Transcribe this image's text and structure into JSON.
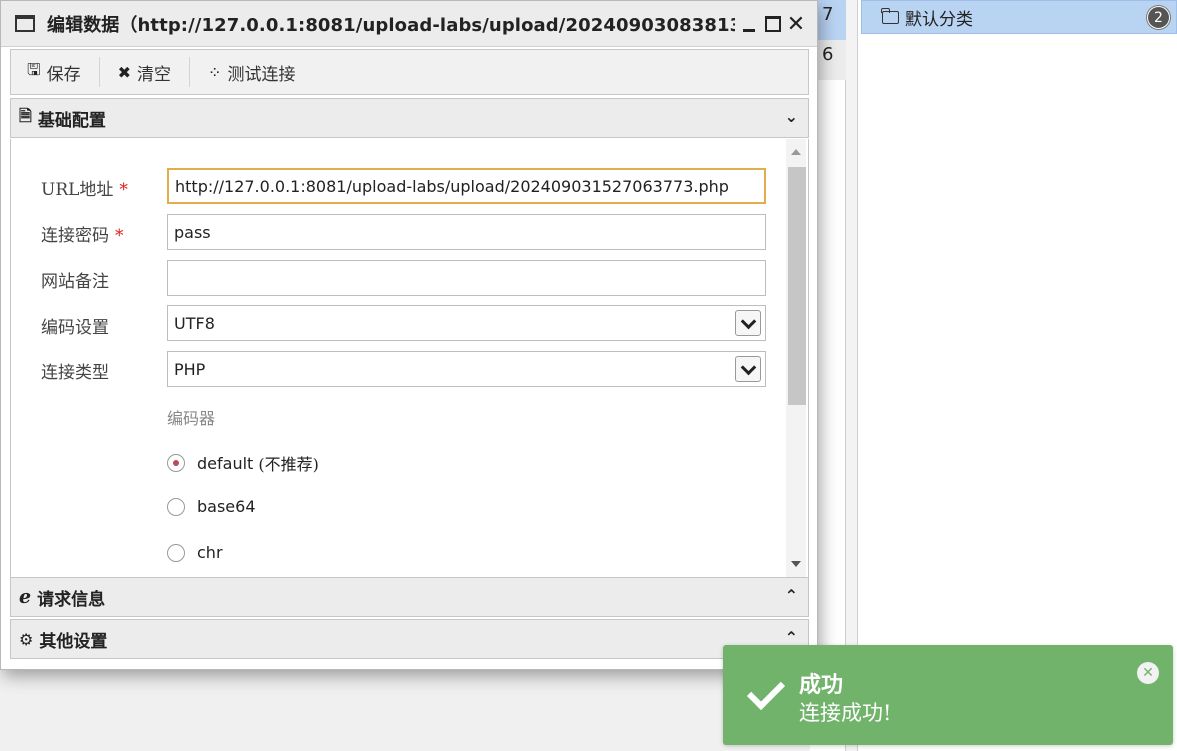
{
  "background": {
    "rows": [
      "7",
      "6"
    ],
    "category": {
      "label": "默认分类",
      "count": "2"
    }
  },
  "dialog": {
    "title": "编辑数据（http://127.0.0.1:8081/upload-labs/upload/202409030838131...",
    "toolbar": {
      "save_label": "保存",
      "clear_label": "清空",
      "test_label": "测试连接"
    },
    "basic_panel": {
      "header": "基础配置",
      "url_label": "URL地址",
      "url_value": "http://127.0.0.1:8081/upload-labs/upload/202409031527063773.php",
      "password_label": "连接密码",
      "password_value": "pass",
      "note_label": "网站备注",
      "note_value": "",
      "encoding_label": "编码设置",
      "encoding_value": "UTF8",
      "type_label": "连接类型",
      "type_value": "PHP",
      "encoder_label": "编码器",
      "encoders": [
        {
          "label": "default",
          "note": "(不推荐)",
          "checked": true
        },
        {
          "label": "base64",
          "checked": false
        },
        {
          "label": "chr",
          "checked": false
        }
      ],
      "required_mark": "*"
    },
    "request_panel": {
      "header": "请求信息"
    },
    "other_panel": {
      "header": "其他设置"
    }
  },
  "toast": {
    "title": "成功",
    "message": "连接成功!",
    "color": "#72b36c"
  },
  "icons": {
    "save": "floppy-icon",
    "clear": "x-icon",
    "test": "spinner-icon",
    "basic": "file-icon",
    "request": "edge-icon",
    "other": "gears-icon"
  }
}
